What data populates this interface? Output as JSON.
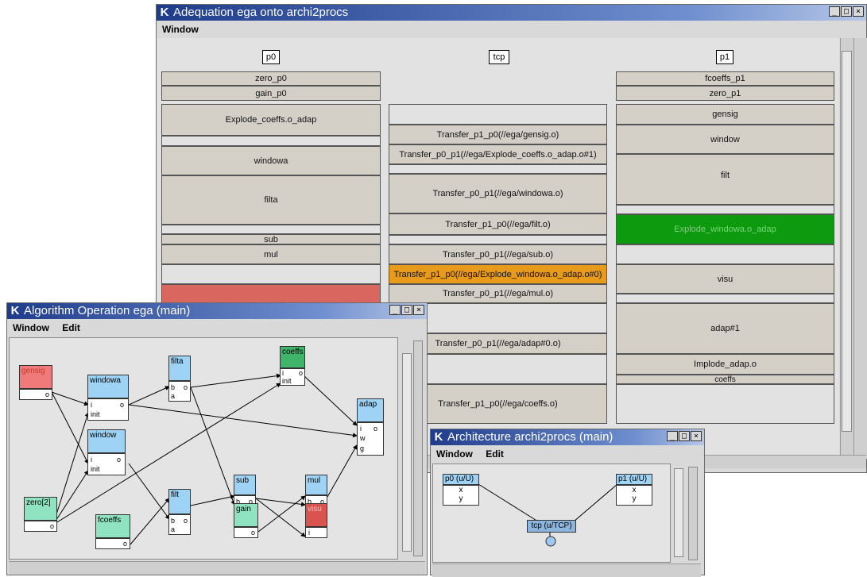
{
  "adequation": {
    "title": "Adequation ega onto archi2procs",
    "menu": [
      "Window"
    ],
    "columns": [
      "p0",
      "tcp",
      "p1"
    ],
    "p0_tasks": [
      "zero_p0",
      "gain_p0",
      "Explode_coeffs.o_adap",
      "windowa",
      "filta",
      "sub",
      "mul"
    ],
    "tcp_tasks": [
      "Transfer_p1_p0(//ega/gensig.o)",
      "Transfer_p0_p1(//ega/Explode_coeffs.o_adap.o#1)",
      "Transfer_p0_p1(//ega/windowa.o)",
      "Transfer_p1_p0(//ega/filt.o)",
      "Transfer_p0_p1(//ega/sub.o)",
      "Transfer_p1_p0(//ega/Explode_windowa.o_adap.o#0)",
      "Transfer_p0_p1(//ega/mul.o)",
      "Transfer_p0_p1(//ega/adap#0.o)",
      "Transfer_p1_p0(//ega/coeffs.o)"
    ],
    "p1_tasks": [
      "fcoeffs_p1",
      "zero_p1",
      "gensig",
      "window",
      "filt",
      "Explode_windowa.o_adap",
      "visu",
      "adap#1",
      "Implode_adap.o",
      "coeffs"
    ]
  },
  "algorithm": {
    "title": "Algorithm Operation ega (main)",
    "menu": [
      "Window",
      "Edit"
    ],
    "ops": {
      "gensig": "gensig",
      "windowa": "windowa",
      "window": "window",
      "filta": "filta",
      "coeffs": "coeffs",
      "adap": "adap",
      "filt": "filt",
      "sub": "sub",
      "mul": "mul",
      "gain": "gain",
      "visu": "visu",
      "zero": "zero[2]",
      "fcoeffs": "fcoeffs"
    },
    "ports": {
      "o": "o",
      "i": "i",
      "init": "init",
      "b": "b",
      "a": "a",
      "w": "w",
      "g": "g"
    }
  },
  "architecture": {
    "title": "Architecture archi2procs (main)",
    "menu": [
      "Window",
      "Edit"
    ],
    "nodes": {
      "p0": "p0 (u/U)",
      "p1": "p1 (u/U)",
      "tcp": "tcp (u/TCP)"
    },
    "ports": {
      "x": "x",
      "y": "y"
    }
  },
  "window_controls": {
    "minimize": "_",
    "maximize": "□",
    "close": "×"
  },
  "colors": {
    "titlebar": "#1f3c8c",
    "op_blue": "#9fd3f5",
    "op_red": "#f07a7a",
    "op_green": "#8fe3c0",
    "op_darkgreen": "#3fb46a",
    "orange": "#e89a1a",
    "green": "#0e9a0e",
    "salmon": "#d9675f",
    "visu": "#d9534f"
  }
}
